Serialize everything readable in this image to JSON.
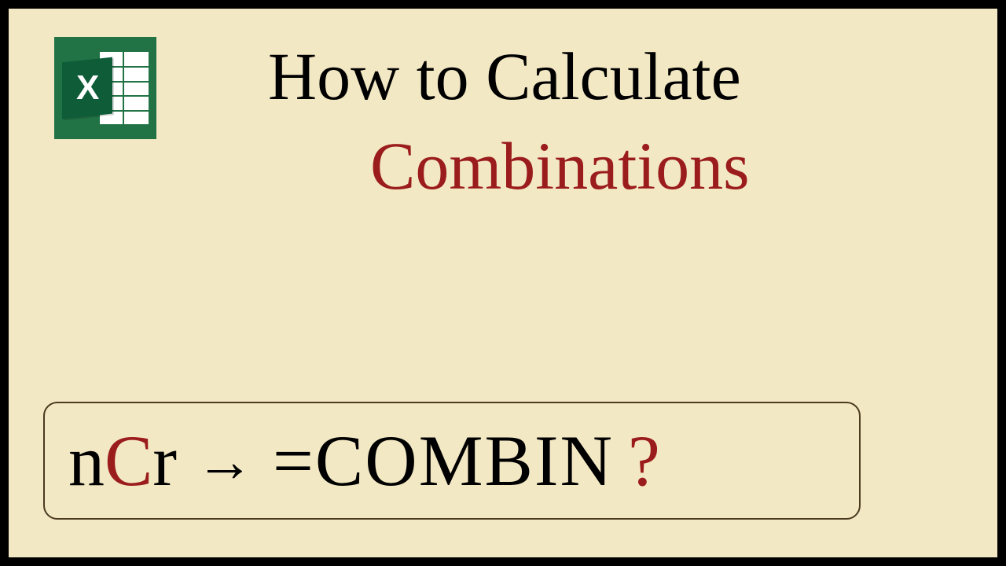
{
  "icon": {
    "letter": "X"
  },
  "title": {
    "line1": "How to Calculate",
    "line2": "Combinations"
  },
  "formula": {
    "n": "n",
    "c": "C",
    "r": "r",
    "arrow": "→",
    "expr": "=COMBIN",
    "question": "?"
  }
}
